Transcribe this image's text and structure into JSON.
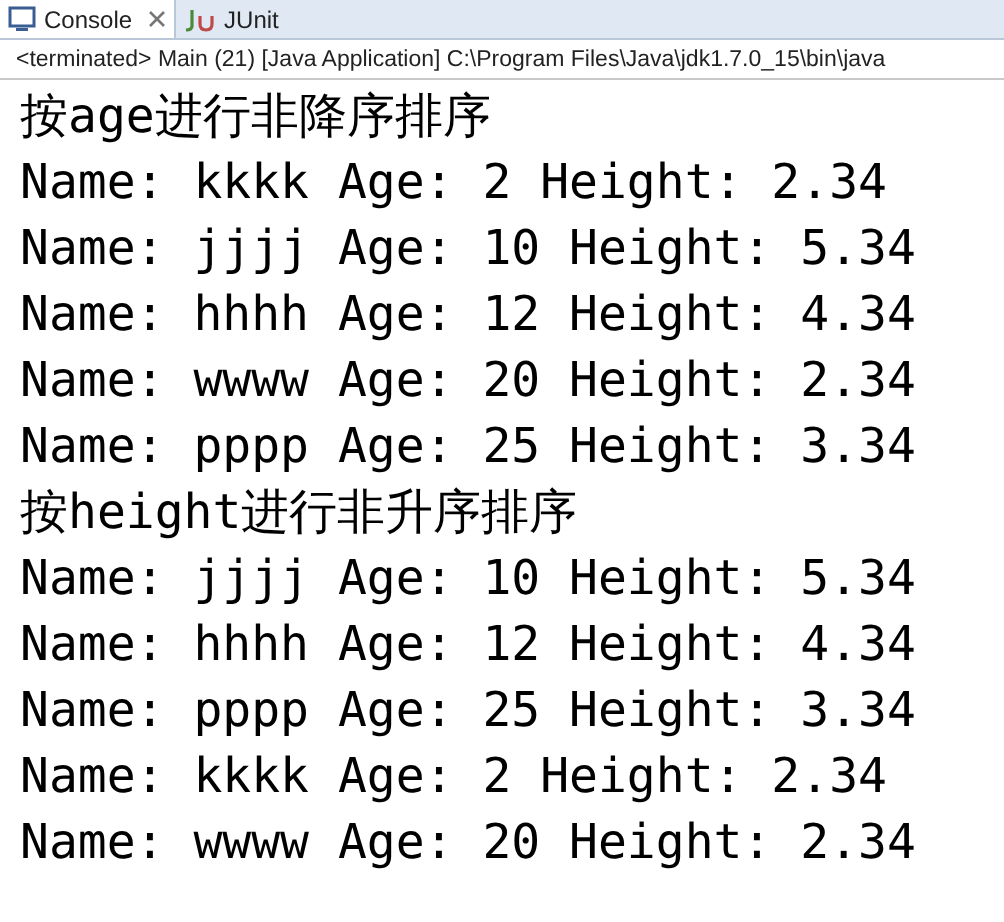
{
  "tabs": [
    {
      "label": "Console",
      "selected": true,
      "closable": true
    },
    {
      "label": "JUnit",
      "selected": false,
      "closable": false
    }
  ],
  "status": "<terminated> Main (21) [Java Application] C:\\Program Files\\Java\\jdk1.7.0_15\\bin\\java",
  "lines": [
    "按age进行非降序排序",
    "Name: kkkk Age: 2 Height: 2.34",
    "Name: jjjj Age: 10 Height: 5.34",
    "Name: hhhh Age: 12 Height: 4.34",
    "Name: wwww Age: 20 Height: 2.34",
    "Name: pppp Age: 25 Height: 3.34",
    "按height进行非升序排序",
    "Name: jjjj Age: 10 Height: 5.34",
    "Name: hhhh Age: 12 Height: 4.34",
    "Name: pppp Age: 25 Height: 3.34",
    "Name: kkkk Age: 2 Height: 2.34",
    "Name: wwww Age: 20 Height: 2.34"
  ]
}
